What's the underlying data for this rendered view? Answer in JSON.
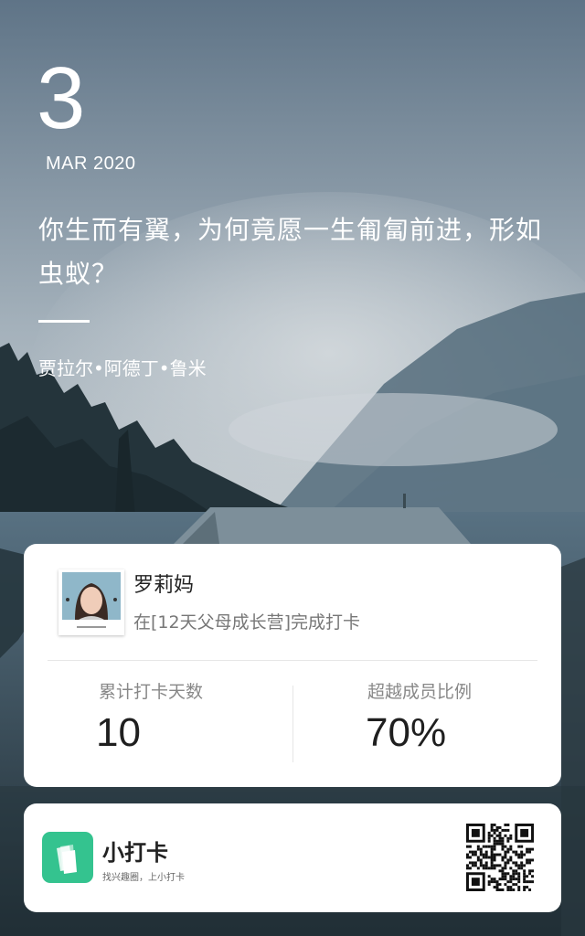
{
  "date": {
    "day": "3",
    "month_year": "MAR 2020"
  },
  "quote": {
    "text": "你生而有翼，为何竟愿一生匍匐前进，形如虫蚁？",
    "author": "贾拉尔•阿德丁•鲁米"
  },
  "checkin_card": {
    "user_name": "罗莉妈",
    "checkin_text": "在[12天父母成长营]完成打卡",
    "stats": [
      {
        "label": "累计打卡天数",
        "value": "10"
      },
      {
        "label": "超越成员比例",
        "value": "70%"
      }
    ]
  },
  "brand": {
    "name": "小打卡",
    "slogan": "找兴趣圈，上小打卡"
  },
  "icons": [
    "avatar-photo",
    "app-logo-icon",
    "qr-code"
  ],
  "colors": {
    "brand_green": "#34c38f",
    "card_bg": "#ffffff",
    "text_white": "#ffffff"
  }
}
